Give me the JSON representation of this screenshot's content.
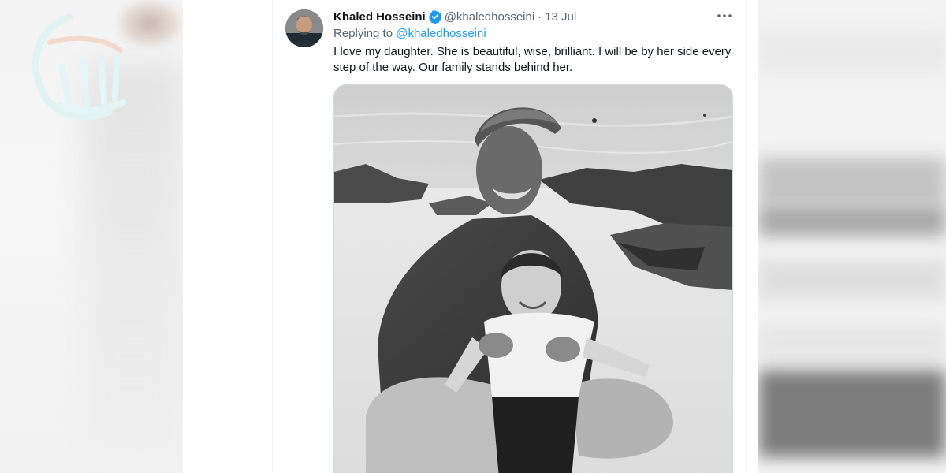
{
  "tweet": {
    "author_name": "Khaled Hosseini",
    "handle": "@khaledhosseini",
    "separator": "·",
    "date": "13 Jul",
    "replying_prefix": "Replying to",
    "replying_to": "@khaledhosseini",
    "text": "I love my daughter. She is beautiful, wise, brilliant. I will be by her side every step of the way. Our family stands behind her.",
    "verified": true
  },
  "icons": {
    "verified": "verified-badge-icon",
    "more": "more-options-icon"
  },
  "colors": {
    "link": "#1d9bf0",
    "text_primary": "#0f1419",
    "text_secondary": "#536471",
    "border": "#cfd9de",
    "watermark": "#dff1f5"
  }
}
